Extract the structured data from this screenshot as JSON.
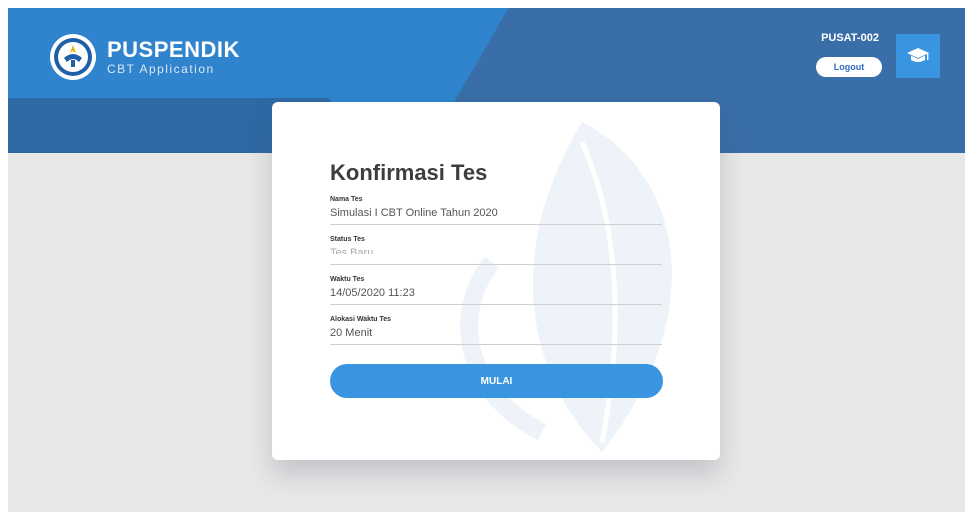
{
  "brand": {
    "name": "PUSPENDIK",
    "subtitle": "CBT Application"
  },
  "user": {
    "id": "PUSAT-002",
    "logout_label": "Logout"
  },
  "icons": {
    "logo": "tut-wuri-handayani-logo",
    "avatar": "graduation-cap-icon"
  },
  "colors": {
    "header": "#3a6ea8",
    "accent": "#3a95e0",
    "page_bg": "#e8e8e8"
  },
  "card": {
    "title": "Konfirmasi Tes",
    "fields": [
      {
        "label": "Nama Tes",
        "value": "Simulasi I CBT Online Tahun 2020"
      },
      {
        "label": "Status Tes",
        "value": "Tes Baru"
      },
      {
        "label": "Waktu Tes",
        "value": "14/05/2020 11:23"
      },
      {
        "label": "Alokasi Waktu Tes",
        "value": "20 Menit"
      }
    ],
    "start_label": "MULAI"
  }
}
